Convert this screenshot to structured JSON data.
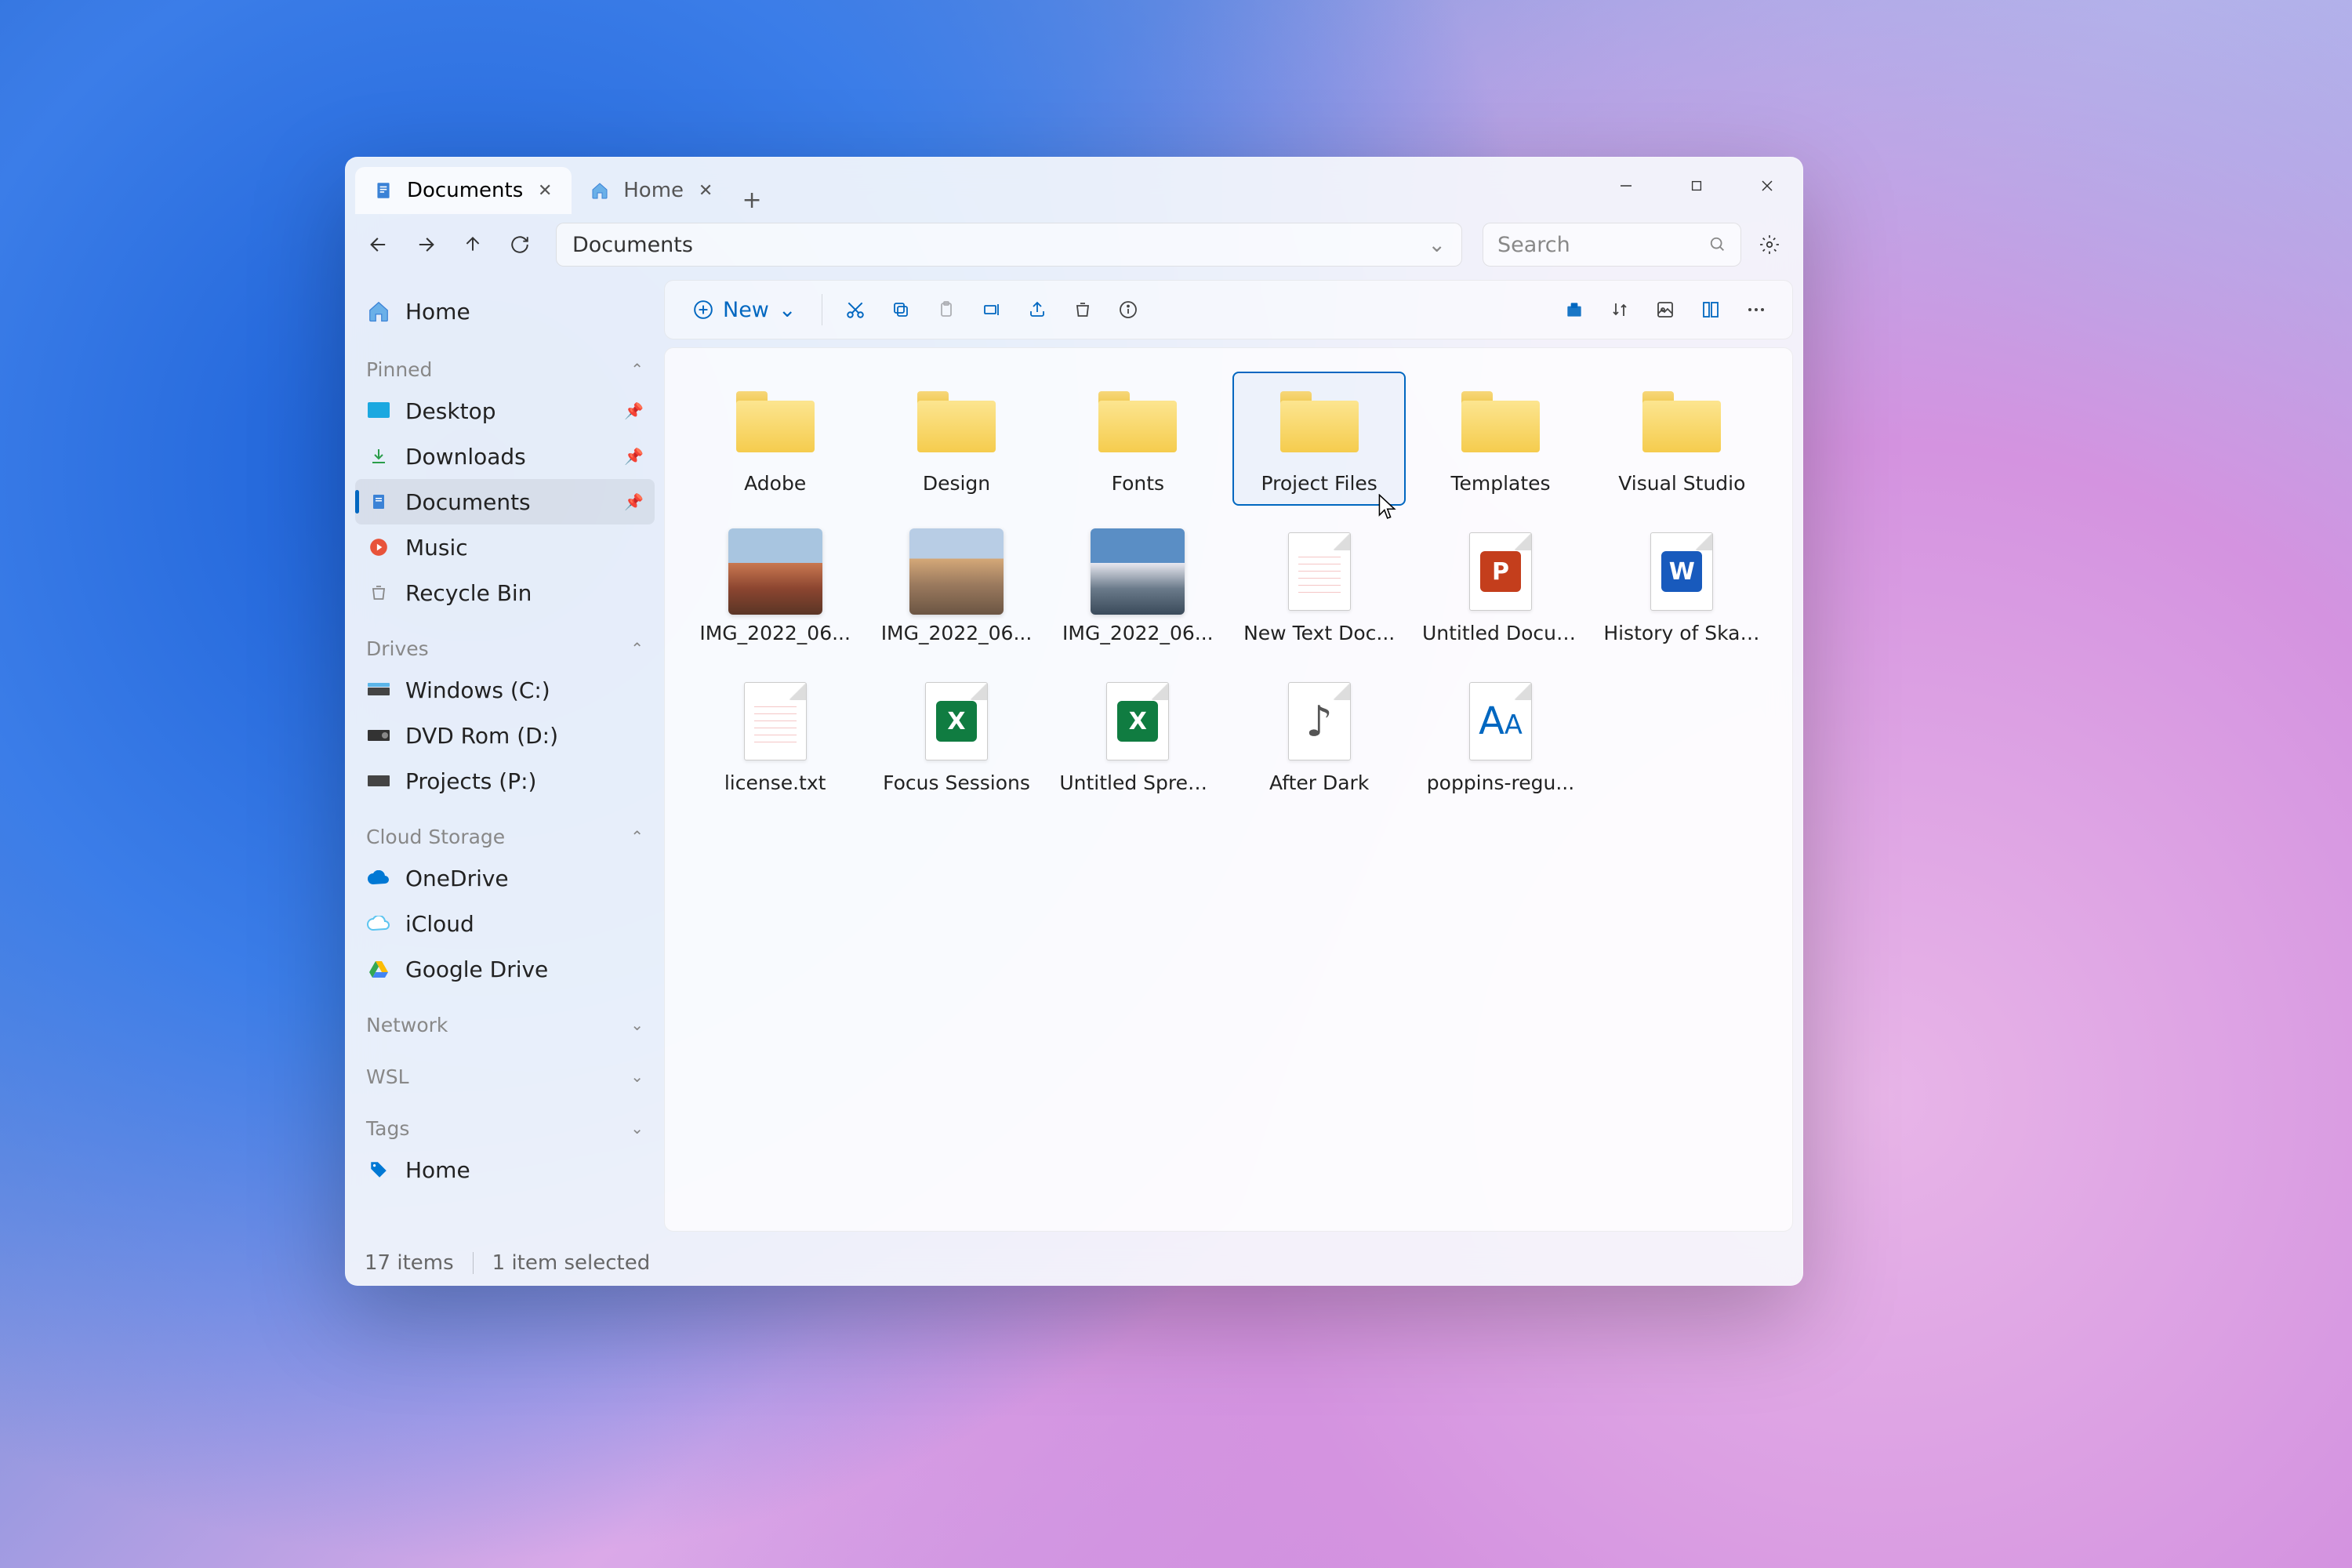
{
  "tabs": [
    {
      "label": "Documents",
      "active": true
    },
    {
      "label": "Home",
      "active": false
    }
  ],
  "address": {
    "path": "Documents"
  },
  "search": {
    "placeholder": "Search"
  },
  "toolbar": {
    "new_label": "New"
  },
  "sidebar": {
    "home": "Home",
    "sections": {
      "pinned": {
        "label": "Pinned",
        "expanded": true,
        "items": [
          {
            "label": "Desktop",
            "icon": "desktop"
          },
          {
            "label": "Downloads",
            "icon": "download"
          },
          {
            "label": "Documents",
            "icon": "document",
            "active": true
          },
          {
            "label": "Music",
            "icon": "music"
          },
          {
            "label": "Recycle Bin",
            "icon": "trash"
          }
        ]
      },
      "drives": {
        "label": "Drives",
        "expanded": true,
        "items": [
          {
            "label": "Windows (C:)",
            "icon": "drive"
          },
          {
            "label": "DVD Rom (D:)",
            "icon": "disc"
          },
          {
            "label": "Projects (P:)",
            "icon": "drive"
          }
        ]
      },
      "cloud": {
        "label": "Cloud Storage",
        "expanded": true,
        "items": [
          {
            "label": "OneDrive",
            "icon": "onedrive"
          },
          {
            "label": "iCloud",
            "icon": "icloud"
          },
          {
            "label": "Google Drive",
            "icon": "gdrive"
          }
        ]
      },
      "network": {
        "label": "Network",
        "expanded": false
      },
      "wsl": {
        "label": "WSL",
        "expanded": false
      },
      "tags": {
        "label": "Tags",
        "expanded": false,
        "items": [
          {
            "label": "Home",
            "icon": "tag"
          }
        ]
      }
    }
  },
  "files": [
    {
      "name": "Adobe",
      "type": "folder"
    },
    {
      "name": "Design",
      "type": "folder"
    },
    {
      "name": "Fonts",
      "type": "folder"
    },
    {
      "name": "Project Files",
      "type": "folder",
      "selected": true
    },
    {
      "name": "Templates",
      "type": "folder"
    },
    {
      "name": "Visual Studio",
      "type": "folder"
    },
    {
      "name": "IMG_2022_06...",
      "type": "image",
      "thumb": "t1"
    },
    {
      "name": "IMG_2022_06...",
      "type": "image",
      "thumb": "t2"
    },
    {
      "name": "IMG_2022_06...",
      "type": "image",
      "thumb": "t3"
    },
    {
      "name": "New Text Doc...",
      "type": "text"
    },
    {
      "name": "Untitled Docum...",
      "type": "ppt"
    },
    {
      "name": "History of Skate...",
      "type": "word"
    },
    {
      "name": "license.txt",
      "type": "text"
    },
    {
      "name": "Focus Sessions",
      "type": "excel"
    },
    {
      "name": "Untitled Spreads...",
      "type": "excel"
    },
    {
      "name": "After Dark",
      "type": "audio"
    },
    {
      "name": "poppins-regu...",
      "type": "font"
    }
  ],
  "status": {
    "count": "17 items",
    "selection": "1 item selected"
  }
}
